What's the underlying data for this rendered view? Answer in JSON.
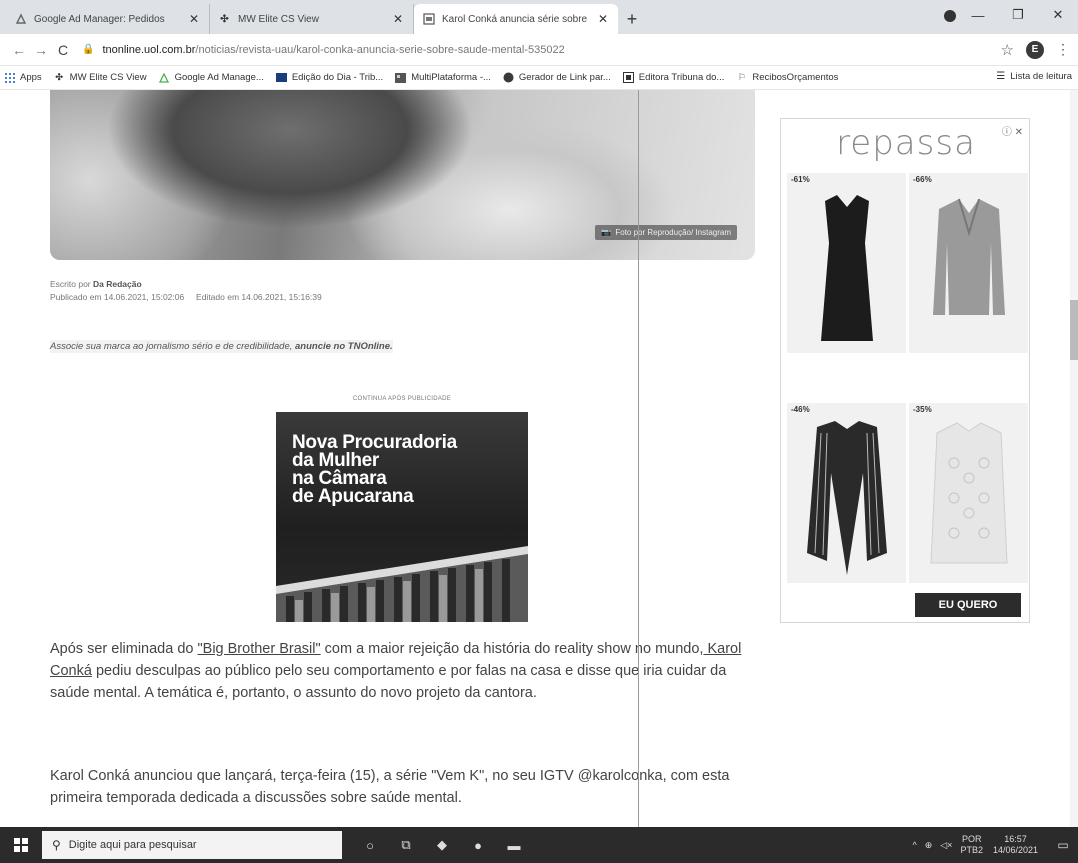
{
  "browser": {
    "tabs": [
      {
        "title": "Google Ad Manager: Pedidos",
        "active": false
      },
      {
        "title": "MW Elite CS View",
        "active": false
      },
      {
        "title": "Karol Conká anuncia série sobre",
        "active": true
      }
    ],
    "new_tab": "+",
    "url_host": "tnonline.uol.com.br",
    "url_path": "/noticias/revista-uau/karol-conka-anuncia-serie-sobre-saude-mental-535022",
    "profile_initial": "E",
    "bookmarks": [
      {
        "label": "Apps",
        "icon": "apps-grid-icon"
      },
      {
        "label": "MW Elite CS View",
        "icon": "mw-icon"
      },
      {
        "label": "Google Ad Manage...",
        "icon": "ad-manager-icon"
      },
      {
        "label": "Edição do Dia - Trib...",
        "icon": "edicao-icon"
      },
      {
        "label": "MultiPlataforma -...",
        "icon": "multiplataforma-icon"
      },
      {
        "label": "Gerador de Link par...",
        "icon": "whatsapp-icon"
      },
      {
        "label": "Editora Tribuna do...",
        "icon": "editora-icon"
      },
      {
        "label": "RecibosOrçamentos",
        "icon": "recibos-icon"
      }
    ],
    "reading_list": "Lista de leitura"
  },
  "article": {
    "photo_credit": "Foto por Reprodução/ Instagram",
    "written_by_label": "Escrito por",
    "author": "Da Redação",
    "published": "Publicado em 14.06.2021, 15:02:06",
    "edited": "Editado em 14.06.2021, 15:16:39",
    "promo_text": "Associe sua marca ao jornalismo sério e de credibilidade,",
    "promo_link": "anuncie no TNOnline.",
    "ad_label": "CONTINUA APÓS PUBLICIDADE",
    "ad_title_lines": [
      "Nova Procuradoria",
      "da Mulher",
      "na Câmara",
      "de Apucarana"
    ],
    "p1_before": "Após ser eliminada do ",
    "p1_link1": "\"Big Brother Brasil\"",
    "p1_mid": " com a maior rejeição da história do reality show no mundo,",
    "p1_link2": " Karol Conká",
    "p1_after": " pediu desculpas ao público pelo seu comportamento e por falas na casa e disse que iria cuidar da saúde mental. A temática é, portanto, o assunto do novo projeto da cantora.",
    "p2": "Karol Conká anunciou que lançará, terça-feira (15), a série \"Vem K\", no seu IGTV @karolconka, com esta primeira temporada dedicada a discussões sobre saúde mental."
  },
  "side_ad": {
    "brand": "repassa",
    "close_label": "ⓘ ✕",
    "products": [
      {
        "discount": "-61%"
      },
      {
        "discount": "-66%"
      },
      {
        "discount": "-46%"
      },
      {
        "discount": "-35%"
      }
    ],
    "cta": "EU QUERO"
  },
  "taskbar": {
    "search_placeholder": "Digite aqui para pesquisar",
    "lang_top": "POR",
    "lang_bottom": "PTB2",
    "time": "16:57",
    "date": "14/06/2021"
  }
}
